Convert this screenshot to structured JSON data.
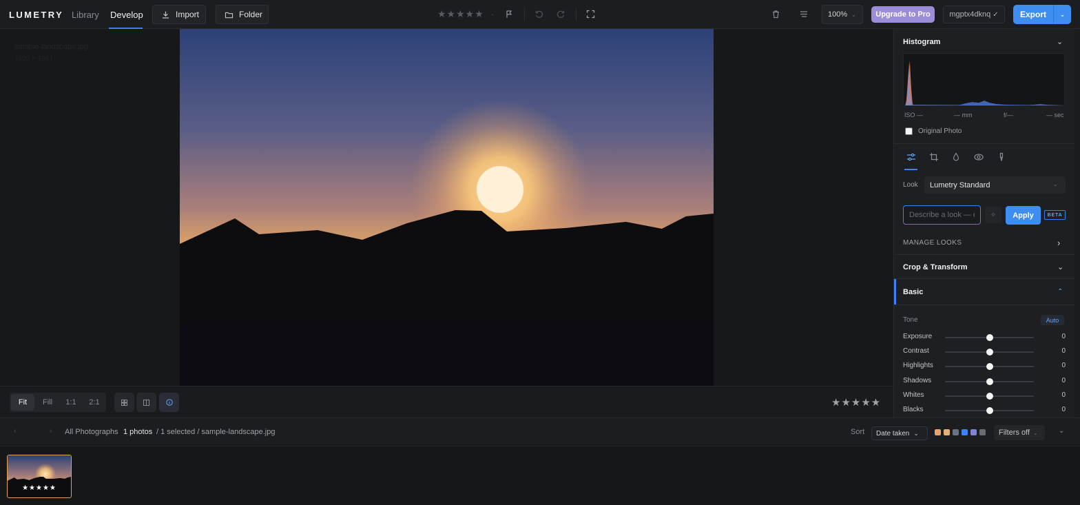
{
  "app": {
    "logo": "LUMETRY",
    "nav": {
      "library": "Library",
      "develop": "Develop"
    },
    "buttons": {
      "import": "Import",
      "folder": "Folder"
    }
  },
  "toolbar": {
    "rating_stars": "★★★★★",
    "rating_dot": "·",
    "zoom": "100%",
    "upgrade": "Upgrade to Pro",
    "user": "mgptx4dknq",
    "user_check": "✓",
    "export": "Export"
  },
  "canvas": {
    "filename": "sample-landscape.jpg",
    "dimensions": "1600 × 1067"
  },
  "viewer": {
    "fit_options": [
      "Fit",
      "Fill",
      "1:1",
      "2:1"
    ],
    "active_fit": "Fit",
    "bottom_stars": "★★★★★"
  },
  "filmbar": {
    "collection": "All Photographs",
    "count": "1 photos",
    "selection": "/ 1 selected / sample-landscape.jpg",
    "sort_label": "Sort",
    "sort_value": "Date taken",
    "color_swatches": [
      "#e6a36b",
      "#e2b17a",
      "#6b7280",
      "#3b82f6",
      "#7c83d9",
      "#6b6c72"
    ],
    "filters": "Filters off",
    "thumb_stars": "★★★★★"
  },
  "panel": {
    "histogram": {
      "title": "Histogram",
      "iso": "ISO —",
      "focal": "— mm",
      "aperture": "f/—",
      "shutter": "— sec",
      "original_photo": "Original Photo"
    },
    "look": {
      "label": "Look",
      "value": "Lumetry Standard",
      "placeholder": "Describe a look — e.g. moody film",
      "apply": "Apply",
      "beta": "BETA",
      "manage": "MANAGE LOOKS"
    },
    "crop": {
      "title": "Crop & Transform"
    },
    "basic": {
      "title": "Basic",
      "tone": "Tone",
      "auto": "Auto",
      "sliders": [
        {
          "label": "Exposure",
          "value": "0",
          "position": 0.5
        },
        {
          "label": "Contrast",
          "value": "0",
          "position": 0.5
        },
        {
          "label": "Highlights",
          "value": "0",
          "position": 0.5
        },
        {
          "label": "Shadows",
          "value": "0",
          "position": 0.5
        },
        {
          "label": "Whites",
          "value": "0",
          "position": 0.5
        },
        {
          "label": "Blacks",
          "value": "0",
          "position": 0.5
        }
      ]
    }
  }
}
